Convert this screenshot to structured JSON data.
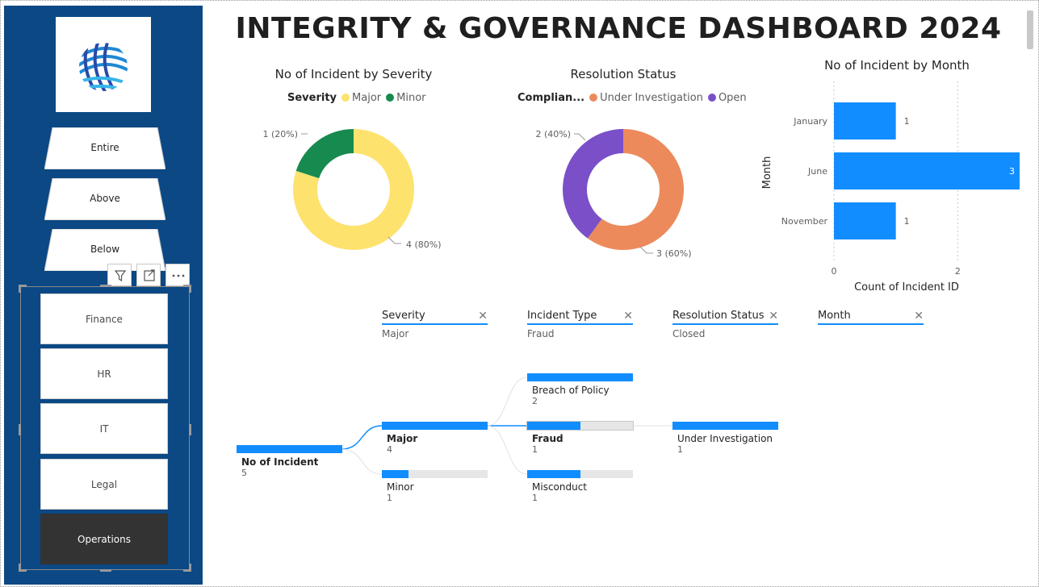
{
  "header": {
    "title": "INTEGRITY & GOVERNANCE DASHBOARD 2024"
  },
  "nav": {
    "items": [
      "Entire",
      "Above",
      "Below"
    ]
  },
  "departments": {
    "items": [
      "Finance",
      "HR",
      "IT",
      "Legal",
      "Operations"
    ],
    "selected": "Operations"
  },
  "icons": {
    "filter": "filter-icon",
    "focus": "focus-mode-icon",
    "more": "more-options-icon",
    "logo": "company-logo"
  },
  "colors": {
    "sidebar": "#0b4884",
    "major": "#fde26e",
    "minor": "#178a4f",
    "under_investigation": "#ec8a5c",
    "open": "#7a4fc8",
    "bar": "#118dff"
  },
  "chart_data": [
    {
      "type": "pie",
      "title": "No of Incident by Severity",
      "legend_title": "Severity",
      "categories": [
        "Major",
        "Minor"
      ],
      "values": [
        4,
        1
      ],
      "labels": [
        "4 (80%)",
        "1 (20%)"
      ]
    },
    {
      "type": "pie",
      "title": "Resolution Status",
      "legend_title": "Complian...",
      "categories": [
        "Under Investigation",
        "Open"
      ],
      "values": [
        3,
        2
      ],
      "labels": [
        "3 (60%)",
        "2 (40%)"
      ]
    },
    {
      "type": "bar",
      "title": "No of Incident by Month",
      "categories": [
        "January",
        "June",
        "November"
      ],
      "values": [
        1,
        3,
        1
      ],
      "xlabel": "Count of Incident ID",
      "ylabel": "Month",
      "xticks": [
        "0",
        "2"
      ],
      "xlim": [
        0,
        3
      ]
    }
  ],
  "filters": [
    {
      "title": "Severity",
      "value": "Major"
    },
    {
      "title": "Incident Type",
      "value": "Fraud"
    },
    {
      "title": "Resolution Status",
      "value": "Closed"
    },
    {
      "title": "Month",
      "value": ""
    }
  ],
  "tree": {
    "root": {
      "label": "No of Incident",
      "value": "5"
    },
    "severity": [
      {
        "label": "Major",
        "value": "4",
        "frac": 1.0
      },
      {
        "label": "Minor",
        "value": "1",
        "frac": 0.25
      }
    ],
    "type": [
      {
        "label": "Breach of Policy",
        "value": "2",
        "frac": 1.0
      },
      {
        "label": "Fraud",
        "value": "1",
        "frac": 0.5
      },
      {
        "label": "Misconduct",
        "value": "1",
        "frac": 0.5
      }
    ],
    "resolution": [
      {
        "label": "Under Investigation",
        "value": "1",
        "frac": 1.0
      }
    ]
  }
}
